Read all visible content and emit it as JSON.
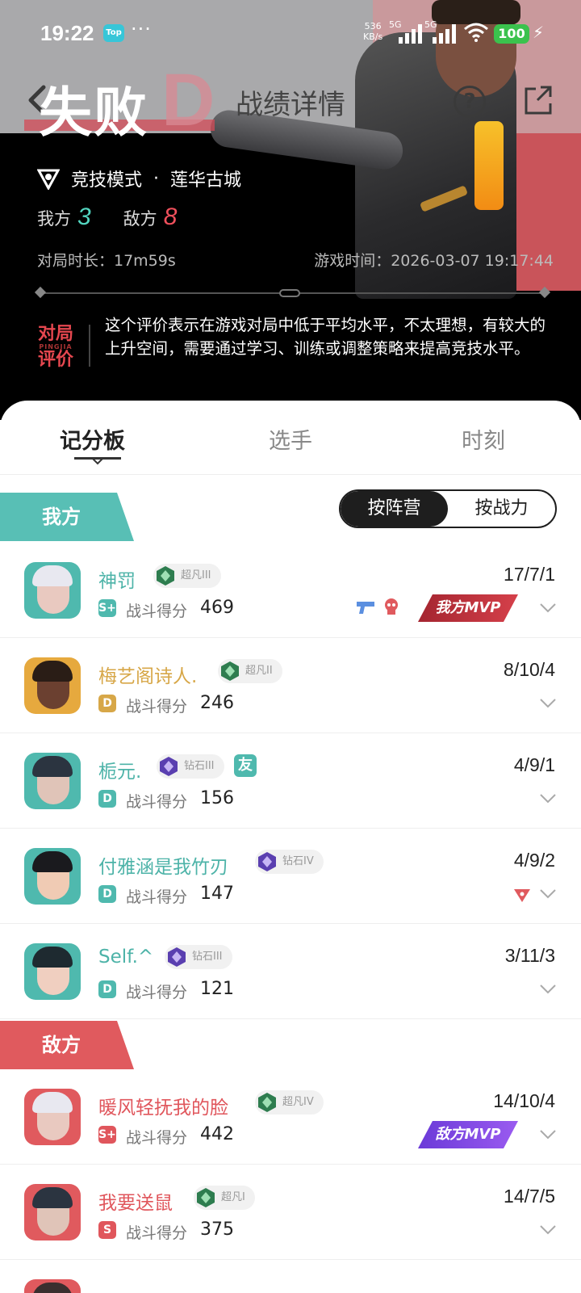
{
  "status_bar": {
    "time": "19:22",
    "app_badge": "Top",
    "more": "···",
    "net_speed_value": "536",
    "net_speed_unit": "KB/s",
    "sim1": "5G",
    "sim2": "5G",
    "battery": "100"
  },
  "header": {
    "result": "失败",
    "grade": "D",
    "title": "战绩详情",
    "mode": "竞技模式",
    "map_sep": "·",
    "map": "莲华古城",
    "ally_label": "我方",
    "ally_score": "3",
    "enemy_label": "敌方",
    "enemy_score": "8",
    "duration": "对局时长：17m59s",
    "game_time": "游戏时间：2026-03-07 19:17:44"
  },
  "evaluation": {
    "badge_line1": "对局",
    "badge_pinyin": "PINGJIA",
    "badge_line2": "评价",
    "text": "这个评价表示在游戏对局中低于平均水平，不太理想，有较大的上升空间，需要通过学习、训练或调整策略来提高竞技水平。"
  },
  "tabs": [
    "记分板",
    "选手",
    "时刻"
  ],
  "sort_toggle": {
    "by_side": "按阵营",
    "by_power": "按战力"
  },
  "ally_banner": "我方",
  "enemy_banner": "敌方",
  "combat_label": "战斗得分",
  "friend_tag": "友",
  "mvp_labels": {
    "ally": "我方MVP",
    "enemy": "敌方MVP"
  },
  "ally_players": [
    {
      "name": "神罚",
      "rank": "超凡III",
      "grade": "S+",
      "score": "469",
      "kda": "17/7/1"
    },
    {
      "name": "梅艺阁诗人.",
      "rank": "超凡II",
      "grade": "D",
      "score": "246",
      "kda": "8/10/4"
    },
    {
      "name": "栀元.",
      "rank": "钻石III",
      "grade": "D",
      "score": "156",
      "kda": "4/9/1"
    },
    {
      "name": "付雅涵是我竹刃",
      "rank": "钻石IV",
      "grade": "D",
      "score": "147",
      "kda": "4/9/2"
    },
    {
      "name": "Self.^",
      "rank": "钻石III",
      "grade": "D",
      "score": "121",
      "kda": "3/11/3"
    }
  ],
  "enemy_players": [
    {
      "name": "暖风轻抚我的脸",
      "rank": "超凡IV",
      "grade": "S+",
      "score": "442",
      "kda": "14/10/4"
    },
    {
      "name": "我要送鼠",
      "rank": "超凡I",
      "grade": "S",
      "score": "375",
      "kda": "14/7/5"
    }
  ],
  "colors": {
    "ally": "#58bfb5",
    "enemy": "#e05a5e",
    "gold": "#d7a748",
    "ascendant_gem": "#2e7d4f",
    "diamond_gem": "#5a3fb0"
  },
  "icons": [
    "back-arrow-icon",
    "help-icon",
    "share-icon",
    "mode-icon",
    "chevron-down-icon",
    "gun-icon",
    "skull-icon",
    "triangle-icon",
    "rank-gem-icon",
    "wifi-icon",
    "signal-icon",
    "battery-icon"
  ]
}
